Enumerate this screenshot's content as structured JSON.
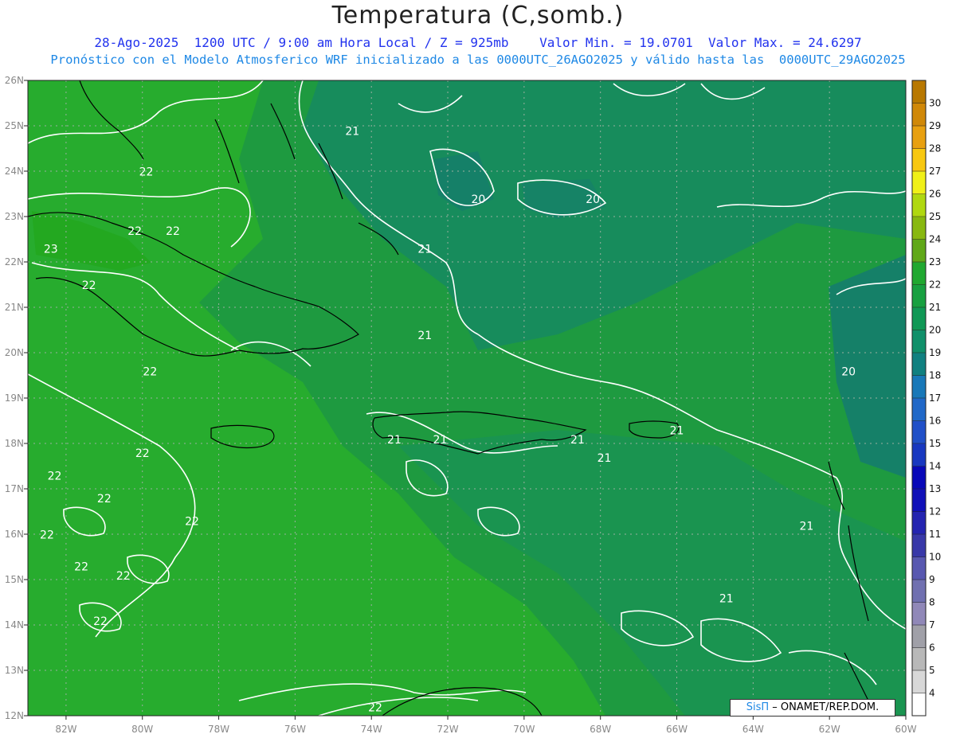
{
  "header": {
    "title": "Temperatura (C,somb.)",
    "line1": "28-Ago-2025  1200 UTC / 9:00 am Hora Local / Z = 925mb    Valor Min. = 19.0701  Valor Max. = 24.6297",
    "line2": "Pronóstico con el Modelo Atmosferico WRF inicializado a las 0000UTC_26AGO2025 y válido hasta las  0000UTC_29AGO2025"
  },
  "map": {
    "lon_range": [
      -83,
      -60
    ],
    "lat_range": [
      12,
      26
    ],
    "lon_ticks": [
      "82W",
      "80W",
      "78W",
      "76W",
      "74W",
      "72W",
      "70W",
      "68W",
      "66W",
      "64W",
      "62W",
      "60W"
    ],
    "lat_ticks": [
      "12N",
      "13N",
      "14N",
      "15N",
      "16N",
      "17N",
      "18N",
      "19N",
      "20N",
      "21N",
      "22N",
      "23N",
      "24N",
      "25N",
      "26N"
    ],
    "contour_labels": [
      {
        "text": "21",
        "lon": -74.5,
        "lat": 24.8
      },
      {
        "text": "22",
        "lon": -79.9,
        "lat": 23.9
      },
      {
        "text": "22",
        "lon": -80.2,
        "lat": 22.6
      },
      {
        "text": "22",
        "lon": -79.2,
        "lat": 22.6
      },
      {
        "text": "23",
        "lon": -82.4,
        "lat": 22.2
      },
      {
        "text": "22",
        "lon": -81.4,
        "lat": 21.4
      },
      {
        "text": "22",
        "lon": -79.8,
        "lat": 19.5
      },
      {
        "text": "20",
        "lon": -71.2,
        "lat": 23.3
      },
      {
        "text": "20",
        "lon": -68.2,
        "lat": 23.3
      },
      {
        "text": "21",
        "lon": -72.6,
        "lat": 22.2
      },
      {
        "text": "21",
        "lon": -72.6,
        "lat": 20.3
      },
      {
        "text": "20",
        "lon": -61.5,
        "lat": 19.5
      },
      {
        "text": "21",
        "lon": -73.4,
        "lat": 18.0
      },
      {
        "text": "21",
        "lon": -72.2,
        "lat": 18.0
      },
      {
        "text": "21",
        "lon": -68.6,
        "lat": 18.0
      },
      {
        "text": "21",
        "lon": -66.0,
        "lat": 18.2
      },
      {
        "text": "21",
        "lon": -67.9,
        "lat": 17.6
      },
      {
        "text": "22",
        "lon": -80.0,
        "lat": 17.7
      },
      {
        "text": "22",
        "lon": -82.3,
        "lat": 17.2
      },
      {
        "text": "22",
        "lon": -81.0,
        "lat": 16.7
      },
      {
        "text": "22",
        "lon": -78.7,
        "lat": 16.2
      },
      {
        "text": "22",
        "lon": -82.5,
        "lat": 15.9
      },
      {
        "text": "22",
        "lon": -81.6,
        "lat": 15.2
      },
      {
        "text": "22",
        "lon": -80.5,
        "lat": 15.0
      },
      {
        "text": "22",
        "lon": -81.1,
        "lat": 14.0
      },
      {
        "text": "21",
        "lon": -62.6,
        "lat": 16.1
      },
      {
        "text": "21",
        "lon": -64.7,
        "lat": 14.5
      },
      {
        "text": "22",
        "lon": -73.9,
        "lat": 12.1
      }
    ]
  },
  "colorbar": {
    "labels": [
      "4",
      "5",
      "6",
      "7",
      "8",
      "9",
      "10",
      "11",
      "12",
      "13",
      "14",
      "15",
      "16",
      "17",
      "18",
      "19",
      "20",
      "21",
      "22",
      "23",
      "24",
      "25",
      "26",
      "27",
      "28",
      "29",
      "30"
    ],
    "colors": [
      "#ffffff",
      "#d8d8d8",
      "#b8b8b8",
      "#a0a0a8",
      "#9088b8",
      "#7070b0",
      "#5858b0",
      "#3838a8",
      "#2424b0",
      "#1010b8",
      "#0808b8",
      "#1838c0",
      "#2050c8",
      "#2068c8",
      "#1878b8",
      "#108080",
      "#10906a",
      "#109855",
      "#18a040",
      "#20a830",
      "#60a818",
      "#88b810",
      "#b0d810",
      "#f0f018",
      "#f8c810",
      "#e8a010",
      "#d08808",
      "#b87800"
    ]
  },
  "credit": {
    "sis": "SisΠ",
    "rest": "– ONAMET/REP.DOM."
  }
}
